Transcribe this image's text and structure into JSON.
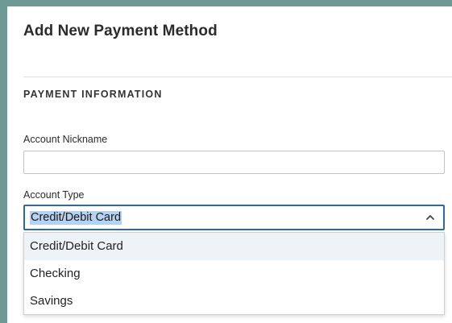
{
  "dialog": {
    "title": "Add New Payment Method"
  },
  "section": {
    "heading": "PAYMENT INFORMATION"
  },
  "account_nickname": {
    "label": "Account Nickname",
    "value": "",
    "placeholder": ""
  },
  "account_type": {
    "label": "Account Type",
    "selected": "Credit/Debit Card",
    "options": [
      "Credit/Debit Card",
      "Checking",
      "Savings"
    ]
  },
  "colors": {
    "accent": "#6f9995",
    "focus_border": "#2e6b9a",
    "selection_highlight": "#b5d2f3",
    "option_hover": "#eef3f7"
  },
  "icons": {
    "dropdown": "chevron-up-icon"
  }
}
